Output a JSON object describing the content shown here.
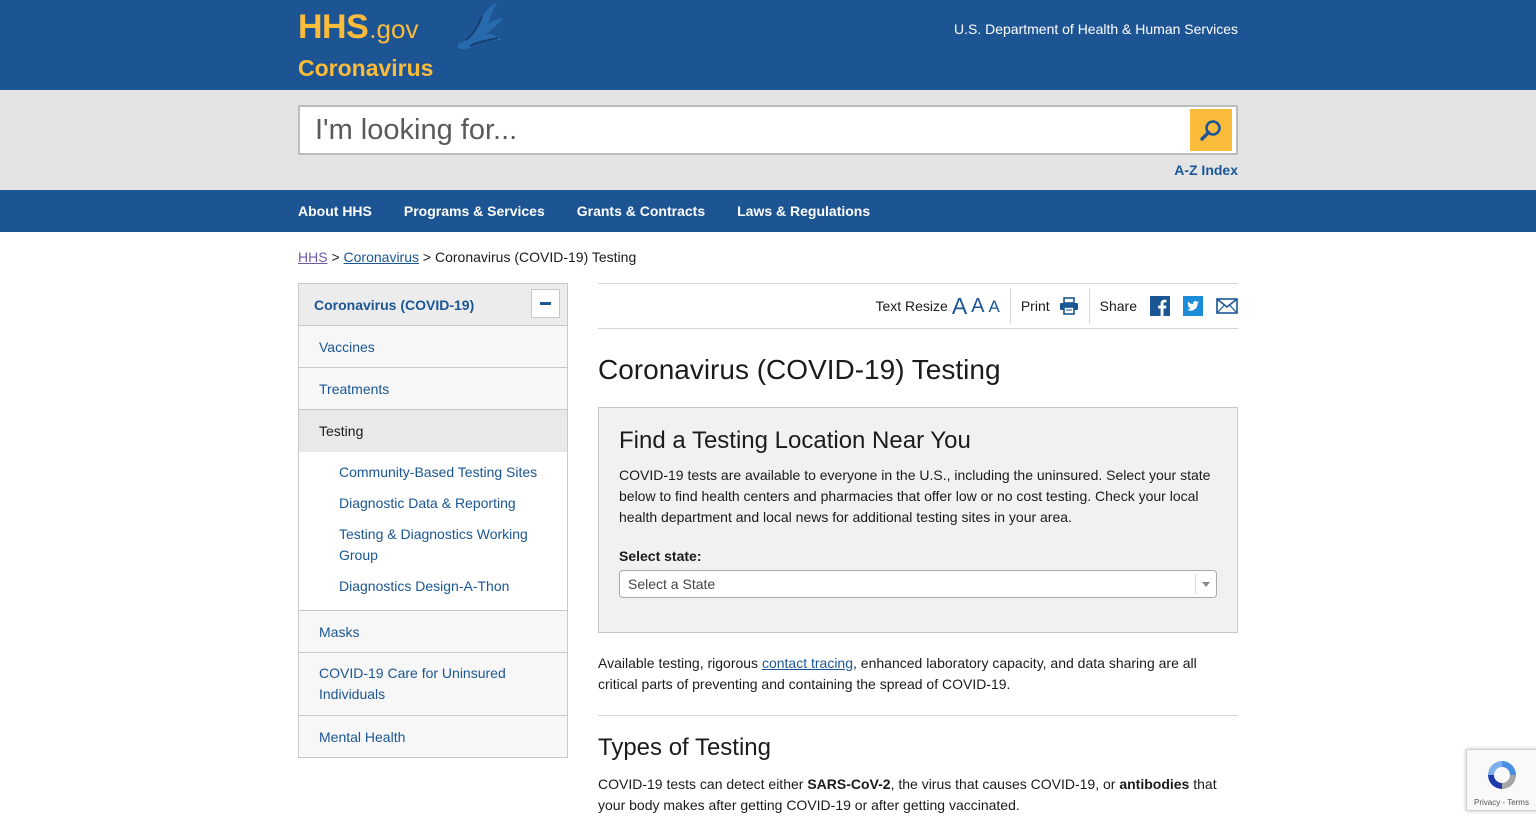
{
  "header": {
    "logo_hhs": "HHS",
    "logo_gov": ".gov",
    "site_name": "Coronavirus",
    "department": "U.S. Department of Health & Human Services"
  },
  "search": {
    "placeholder": "I'm looking for...",
    "az_index": "A-Z Index"
  },
  "nav": {
    "items": [
      "About HHS",
      "Programs & Services",
      "Grants & Contracts",
      "Laws & Regulations"
    ]
  },
  "breadcrumb": {
    "items": [
      "HHS",
      "Coronavirus",
      "Coronavirus (COVID-19) Testing"
    ],
    "separator": ">"
  },
  "sidebar": {
    "heading": "Coronavirus (COVID-19)",
    "items": [
      {
        "label": "Vaccines"
      },
      {
        "label": "Treatments"
      },
      {
        "label": "Testing",
        "active": true,
        "children": [
          "Community-Based Testing Sites",
          "Diagnostic Data & Reporting",
          "Testing & Diagnostics Working Group",
          "Diagnostics Design-A-Thon"
        ]
      },
      {
        "label": "Masks"
      },
      {
        "label": "COVID-19 Care for Uninsured Individuals"
      },
      {
        "label": "Mental Health"
      }
    ]
  },
  "toolbar": {
    "text_resize": "Text Resize",
    "resize_letters": [
      "A",
      "A",
      "A"
    ],
    "print": "Print",
    "share": "Share"
  },
  "main": {
    "title": "Coronavirus (COVID-19) Testing",
    "locator": {
      "heading": "Find a Testing Location Near You",
      "body": "COVID-19 tests are available to everyone in the U.S., including the uninsured. Select your state below to find health centers and pharmacies that offer low or no cost testing. Check your local health department and local news for additional testing sites in your area.",
      "select_label": "Select state:",
      "select_value": "Select a State"
    },
    "para1_before": "Available testing, rigorous ",
    "para1_link": "contact tracing",
    "para1_after": ", enhanced laboratory capacity, and data sharing are all critical parts of preventing and containing the spread of COVID-19.",
    "types_heading": "Types of Testing",
    "para2_a": "COVID-19 tests can detect either ",
    "para2_b": "SARS-CoV-2",
    "para2_c": ", the virus that causes COVID-19, or ",
    "para2_d": "antibodies",
    "para2_e": " that your body makes after getting COVID-19 or after getting vaccinated."
  },
  "recaptcha": {
    "text": "Privacy - Terms"
  },
  "colors": {
    "brand_blue": "#1c5494",
    "brand_gold": "#fbbc3c",
    "link_blue": "#1a5694"
  }
}
